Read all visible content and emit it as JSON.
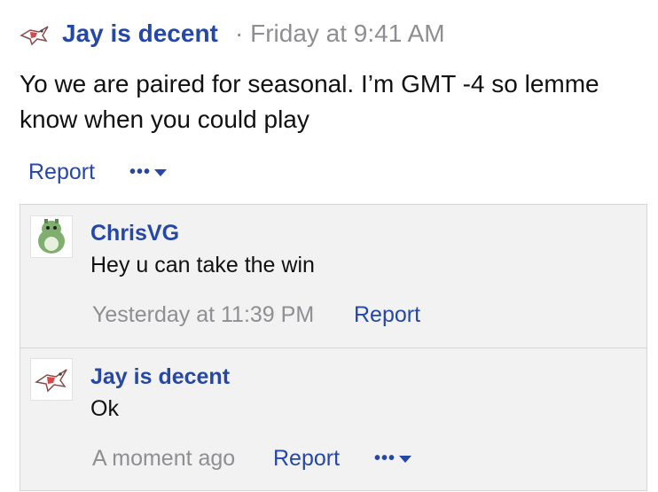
{
  "post": {
    "author": "Jay is decent",
    "timestamp": "· Friday at 9:41 AM",
    "avatar_icon": "latias-avatar-icon",
    "body": "Yo we are paired for seasonal. I’m GMT -4 so lemme know when you could play",
    "report_label": "Report",
    "more_dots": "•••"
  },
  "comments": [
    {
      "author": "ChrisVG",
      "avatar_icon": "green-creature-avatar-icon",
      "text": "Hey u can take the win",
      "time": "Yesterday at 11:39 PM",
      "report_label": "Report"
    },
    {
      "author": "Jay is decent",
      "avatar_icon": "latias-avatar-icon",
      "text": "Ok",
      "time": "A moment ago",
      "report_label": "Report",
      "more_dots": "•••"
    }
  ],
  "colors": {
    "link": "#2547a8",
    "muted": "#8e8e93",
    "thread_bg": "#f2f2f2",
    "border": "#d6d6d6"
  }
}
